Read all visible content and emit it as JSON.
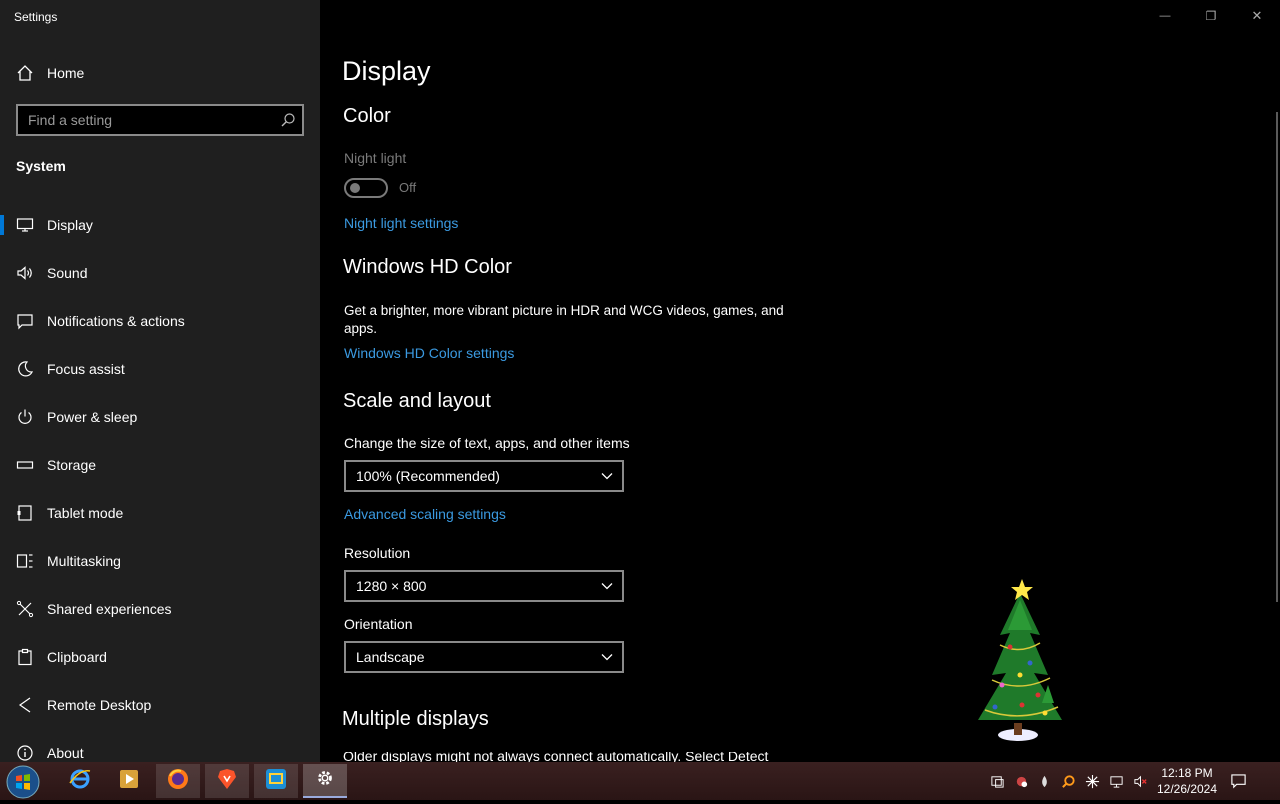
{
  "window": {
    "title": "Settings",
    "minimize": "—",
    "restore": "❐",
    "close": "✕"
  },
  "sidebar": {
    "home_label": "Home",
    "search_placeholder": "Find a setting",
    "section_label": "System",
    "items": [
      {
        "label": "Display",
        "icon": "monitor-icon"
      },
      {
        "label": "Sound",
        "icon": "speaker-icon"
      },
      {
        "label": "Notifications & actions",
        "icon": "message-icon"
      },
      {
        "label": "Focus assist",
        "icon": "moon-icon"
      },
      {
        "label": "Power & sleep",
        "icon": "power-icon"
      },
      {
        "label": "Storage",
        "icon": "storage-icon"
      },
      {
        "label": "Tablet mode",
        "icon": "tablet-icon"
      },
      {
        "label": "Multitasking",
        "icon": "multitasking-icon"
      },
      {
        "label": "Shared experiences",
        "icon": "shared-icon"
      },
      {
        "label": "Clipboard",
        "icon": "clipboard-icon"
      },
      {
        "label": "Remote Desktop",
        "icon": "remote-icon"
      },
      {
        "label": "About",
        "icon": "info-icon"
      }
    ]
  },
  "main": {
    "page_title": "Display",
    "color": {
      "heading": "Color",
      "night_light_label": "Night light",
      "night_light_state": "Off",
      "night_light_link": "Night light settings"
    },
    "hd_color": {
      "heading": "Windows HD Color",
      "description": "Get a brighter, more vibrant picture in HDR and WCG videos, games, and apps.",
      "link": "Windows HD Color settings"
    },
    "scale": {
      "heading": "Scale and layout",
      "size_label": "Change the size of text, apps, and other items",
      "size_value": "100% (Recommended)",
      "advanced_link": "Advanced scaling settings",
      "resolution_label": "Resolution",
      "resolution_value": "1280 × 800",
      "orientation_label": "Orientation",
      "orientation_value": "Landscape"
    },
    "multiple": {
      "heading": "Multiple displays",
      "cut_text": "Older displays might not always connect automatically. Select Detect to"
    }
  },
  "taskbar": {
    "clock_time": "12:18 PM",
    "clock_date": "12/26/2024"
  },
  "colors": {
    "accent": "#0078d7",
    "link": "#3b9ae1",
    "sidebar_bg": "#1f1f1f",
    "main_bg": "#000000"
  }
}
